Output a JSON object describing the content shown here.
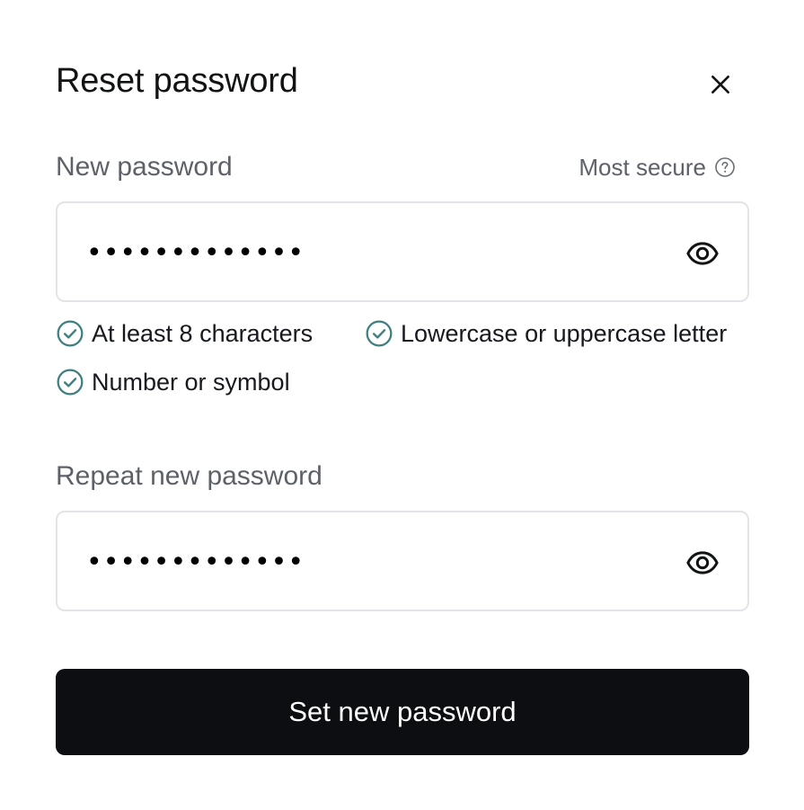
{
  "dialog": {
    "title": "Reset password",
    "close_icon": "close-icon"
  },
  "new_password": {
    "label": "New password",
    "strength_label": "Most secure",
    "strength_icon": "help-circle-icon",
    "value": "•••••••••••••",
    "toggle_icon": "eye-icon"
  },
  "requirements": [
    {
      "label": "At least 8 characters",
      "met": true,
      "icon": "check-circle-icon"
    },
    {
      "label": "Lowercase or uppercase letter",
      "met": true,
      "icon": "check-circle-icon"
    },
    {
      "label": "Number or symbol",
      "met": true,
      "icon": "check-circle-icon"
    }
  ],
  "repeat_password": {
    "label": "Repeat new password",
    "value": "•••••••••••••",
    "toggle_icon": "eye-icon"
  },
  "submit": {
    "label": "Set new password"
  },
  "colors": {
    "check": "#3f7f80",
    "button_bg": "#0c0e11",
    "muted_text": "#5d6269",
    "input_border": "#e2e4e8"
  }
}
